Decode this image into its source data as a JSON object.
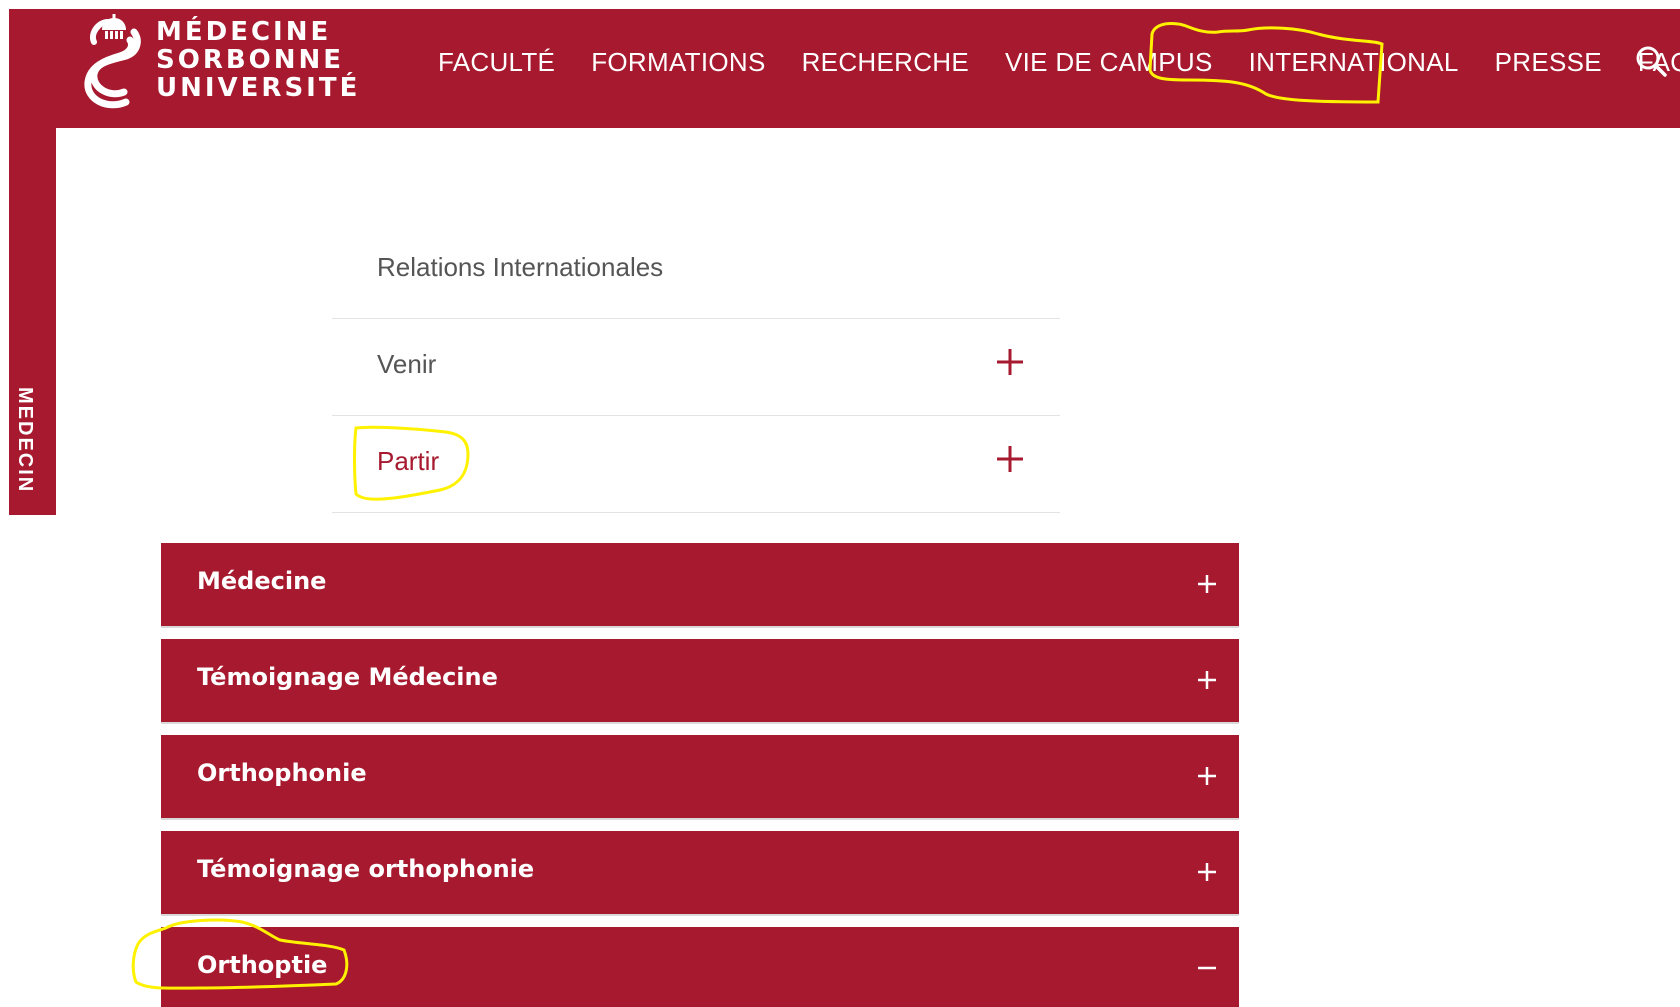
{
  "brand": {
    "line1": "MÉDECINE",
    "line2": "SORBONNE",
    "line3": "UNIVERSITÉ",
    "color": "#a6192e",
    "icon": "sorbonne-s-dome-logo"
  },
  "sidebar": {
    "label": "MEDECIN"
  },
  "nav": {
    "items": [
      {
        "label": "FACULTÉ"
      },
      {
        "label": "FORMATIONS"
      },
      {
        "label": "RECHERCHE"
      },
      {
        "label": "VIE DE CAMPUS"
      },
      {
        "label": "INTERNATIONAL"
      },
      {
        "label": "PRESSE"
      },
      {
        "label": "FAQ"
      }
    ],
    "search_icon": "search-icon"
  },
  "submenu": {
    "title": "Relations Internationales",
    "items": [
      {
        "label": "Venir",
        "icon": "plus-icon"
      },
      {
        "label": "Partir",
        "icon": "plus-icon",
        "active": true
      }
    ]
  },
  "accordion": {
    "items": [
      {
        "label": "Médecine",
        "state": "collapsed"
      },
      {
        "label": "Témoignage Médecine",
        "state": "collapsed"
      },
      {
        "label": "Orthophonie",
        "state": "collapsed"
      },
      {
        "label": "Témoignage orthophonie",
        "state": "collapsed"
      },
      {
        "label": "Orthoptie",
        "state": "expanded"
      }
    ]
  },
  "annotation_color": "#fff200"
}
